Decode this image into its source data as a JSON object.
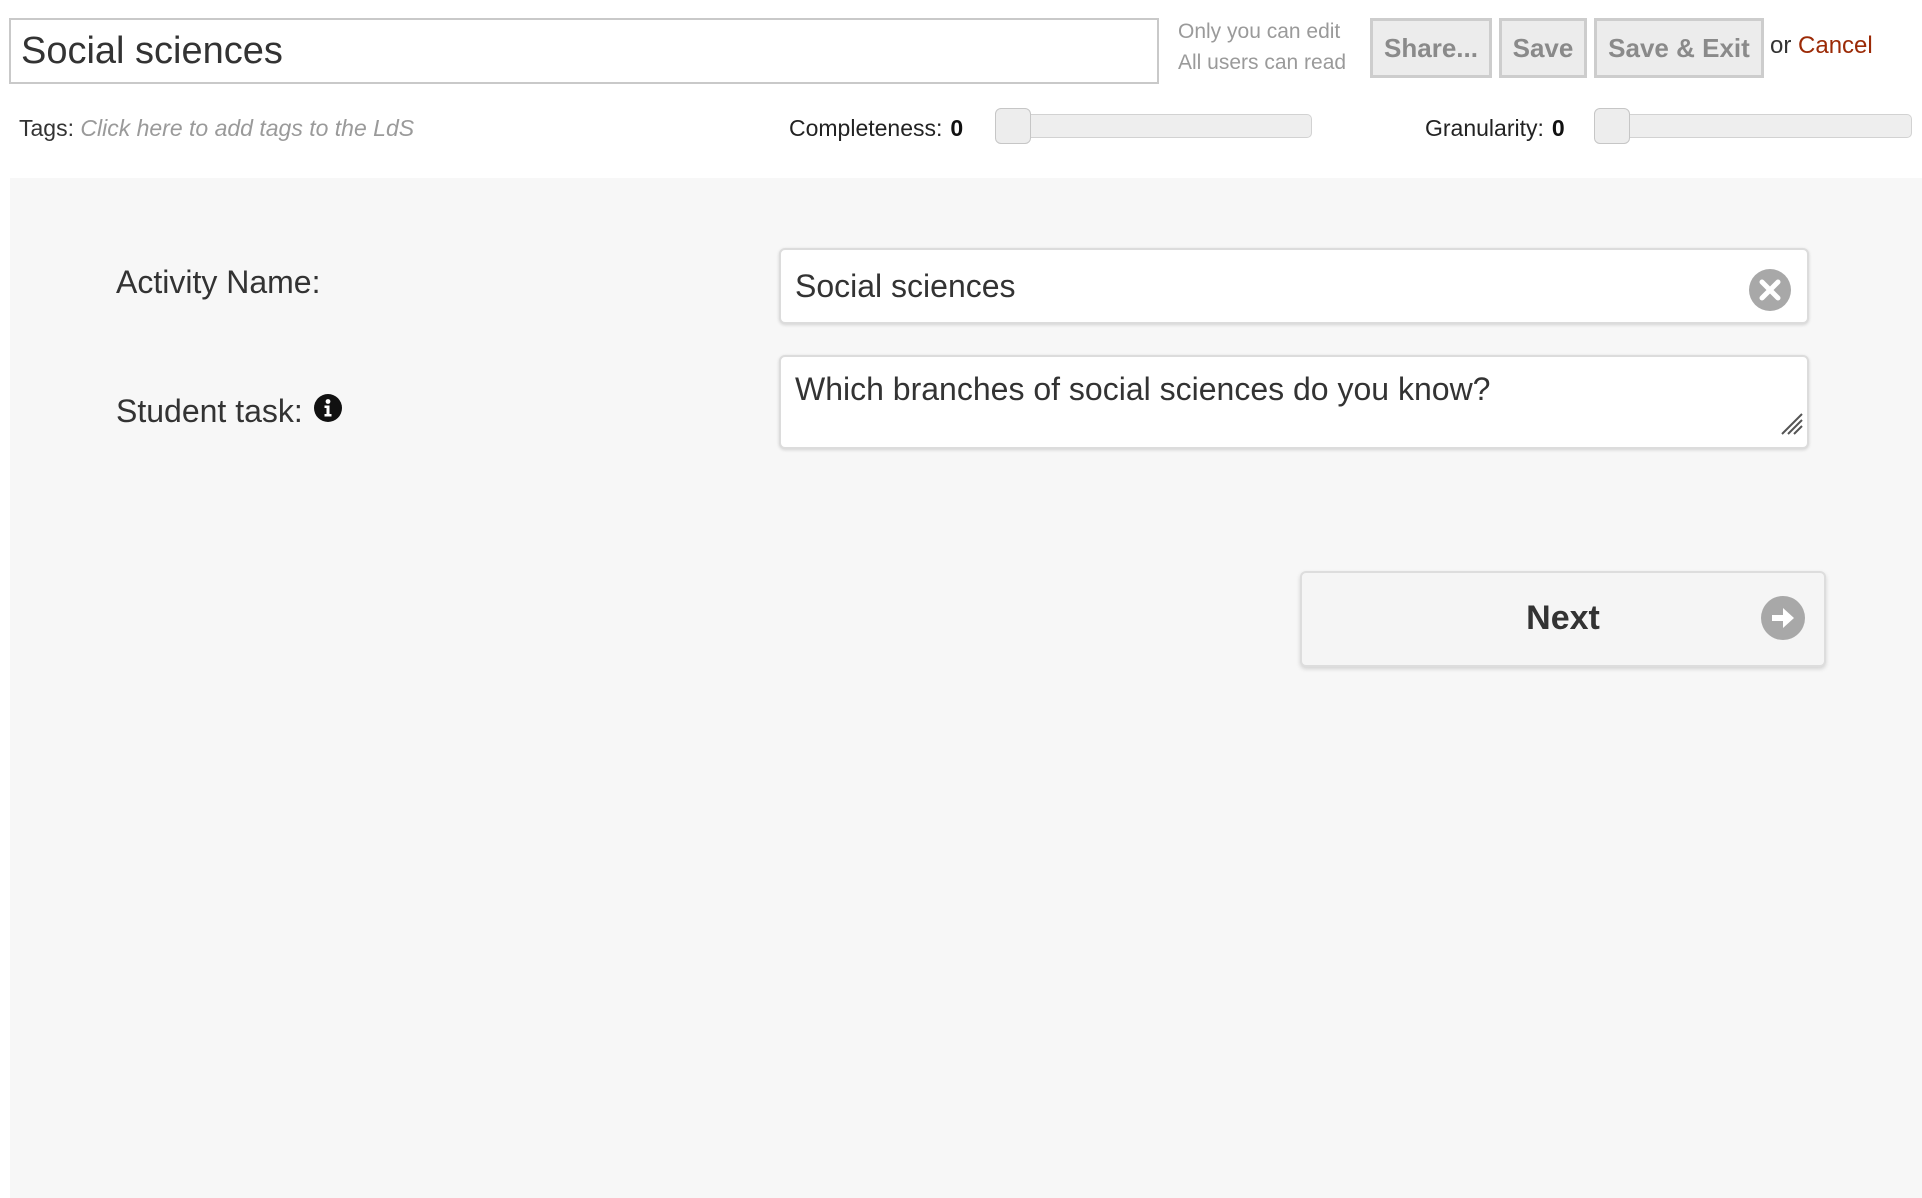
{
  "header": {
    "title_value": "Social sciences",
    "permissions": {
      "edit": "Only you can edit",
      "read": "All users can read"
    },
    "buttons": {
      "share": "Share...",
      "save": "Save",
      "save_exit": "Save & Exit"
    },
    "or_text": "or",
    "cancel": "Cancel"
  },
  "meta_row": {
    "tags_label": "Tags:",
    "tags_placeholder": "Click here to add tags to the LdS",
    "completeness": {
      "label": "Completeness:",
      "value": "0"
    },
    "granularity": {
      "label": "Granularity:",
      "value": "0"
    }
  },
  "form": {
    "activity_name_label": "Activity Name:",
    "activity_name_value": "Social sciences",
    "student_task_label": "Student task:",
    "student_task_value": "Which branches of social sciences do you know?",
    "next_label": "Next"
  },
  "icons": {
    "info": "info-icon",
    "clear": "clear-icon",
    "next": "arrow-right-circle-icon",
    "resize": "resize-grip-icon"
  },
  "colors": {
    "cancel_link": "#9b2a06",
    "panel_bg": "#f7f7f7",
    "button_bg": "#ececec",
    "muted_text": "#9a9a9a"
  }
}
